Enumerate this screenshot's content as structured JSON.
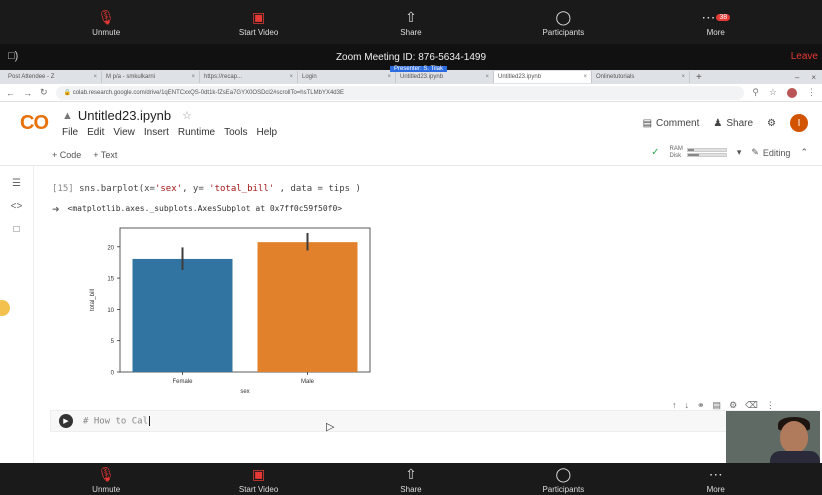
{
  "zoom": {
    "top_buttons": [
      {
        "label": "Unmute",
        "icon": "mic-muted-icon"
      },
      {
        "label": "Start Video",
        "icon": "video-off-icon"
      },
      {
        "label": "Share",
        "icon": "share-icon"
      },
      {
        "label": "Participants",
        "icon": "participants-icon"
      },
      {
        "label": "More",
        "icon": "more-icon",
        "badge": "38"
      }
    ],
    "meeting_title": "Zoom Meeting ID: 876-5634-1499",
    "leave_label": "Leave",
    "presenter_label": "Presenter: S. Tilak",
    "bottom_buttons": [
      {
        "label": "Unmute"
      },
      {
        "label": "Start Video"
      },
      {
        "label": "Share"
      },
      {
        "label": "Participants"
      },
      {
        "label": "More"
      }
    ]
  },
  "browser": {
    "tabs": [
      "Post Attendee - Z",
      "M p/a - smkulkarni",
      "https://recap...",
      "Login",
      "Untitled23.ipynb",
      "Untitled23.ipynb",
      "Onlinetutorials"
    ],
    "url": "colab.research.google.com/drive/1qENTCxxQS-0dt1k-fZsEa7GYX0OSDcl2#scrollTo=hsTLMbYX4d3E"
  },
  "colab": {
    "logo": "CO",
    "notebook_title": "Untitled23.ipynb",
    "menu": [
      "File",
      "Edit",
      "View",
      "Insert",
      "Runtime",
      "Tools",
      "Help"
    ],
    "comment_label": "Comment",
    "share_label": "Share",
    "avatar_letter": "I",
    "add_code": "+ Code",
    "add_text": "+ Text",
    "ram_label": "RAM",
    "disk_label": "Disk",
    "editing_label": "Editing"
  },
  "cell": {
    "exec_count": "[15]",
    "code_prefix": "sns.barplot(x=",
    "code_x": "'sex'",
    "code_mid": ", y= ",
    "code_y": "'total_bill'",
    "code_suffix": " , data = tips )",
    "output_text": "<matplotlib.axes._subplots.AxesSubplot at 0x7ff0c59f50f0>"
  },
  "next_cell": {
    "code": "# How to Cal"
  },
  "chart_data": {
    "type": "bar",
    "categories": [
      "Female",
      "Male"
    ],
    "values": [
      18.06,
      20.74
    ],
    "error_low": [
      16.3,
      19.4
    ],
    "error_high": [
      19.9,
      22.2
    ],
    "colors": [
      "#3274a1",
      "#e1812c"
    ],
    "xlabel": "sex",
    "ylabel": "total_bill",
    "ylim": [
      0,
      23
    ],
    "yticks": [
      0,
      5,
      10,
      15,
      20
    ]
  }
}
